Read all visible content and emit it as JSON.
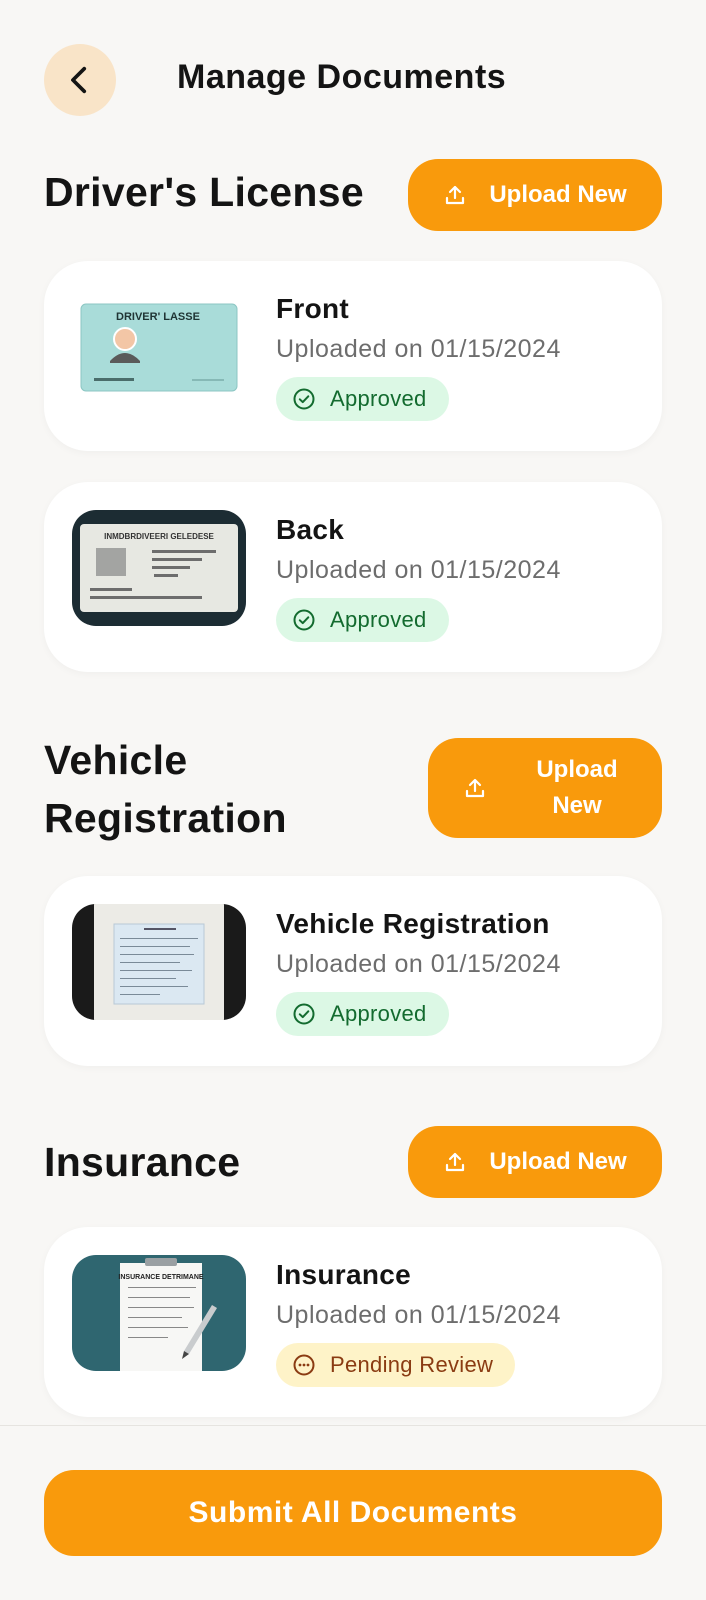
{
  "header": {
    "title": "Manage Documents",
    "back_icon": "chevron-left-icon"
  },
  "colors": {
    "accent": "#f99a0c",
    "back_button_bg": "#f9e4c8",
    "approved_bg": "#dcf8e5",
    "approved_text": "#136b2f",
    "pending_bg": "#fef3c8",
    "pending_text": "#8a3b12"
  },
  "sections": [
    {
      "title": "Driver's License",
      "upload_label": "Upload New",
      "documents": [
        {
          "name": "Front",
          "uploaded": "Uploaded on 01/15/2024",
          "status": "Approved",
          "thumb_text": "DRIVER' LASSE"
        },
        {
          "name": "Back",
          "uploaded": "Uploaded on 01/15/2024",
          "status": "Approved",
          "thumb_text": "INMDBRDIVEERI GELEDESE"
        }
      ]
    },
    {
      "title": "Vehicle Registration",
      "upload_label": "Upload New",
      "documents": [
        {
          "name": "Vehicle Registration",
          "uploaded": "Uploaded on 01/15/2024",
          "status": "Approved"
        }
      ]
    },
    {
      "title": "Insurance",
      "upload_label": "Upload New",
      "documents": [
        {
          "name": "Insurance",
          "uploaded": "Uploaded on 01/15/2024",
          "status": "Pending Review",
          "thumb_text": "INSURANCE DETRIMANE"
        }
      ]
    }
  ],
  "footer": {
    "submit_label": "Submit All Documents"
  }
}
